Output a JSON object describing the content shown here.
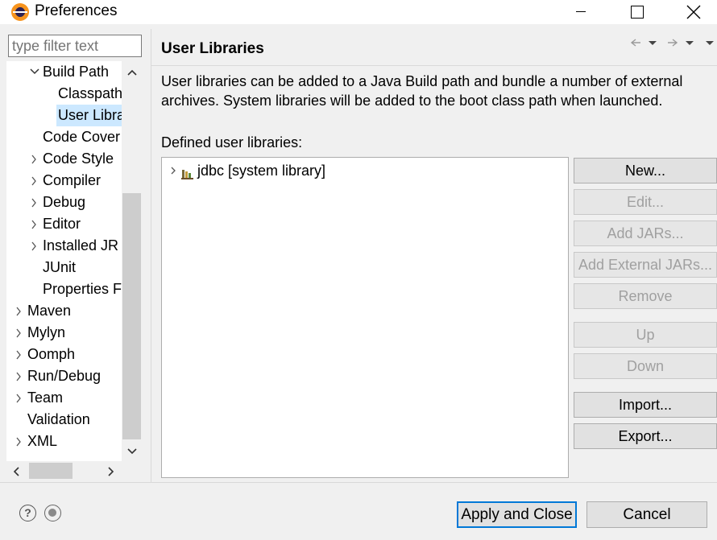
{
  "window": {
    "title": "Preferences"
  },
  "filter": {
    "placeholder": "type filter text"
  },
  "tree": {
    "items": [
      {
        "label": "Build Path",
        "indent": 1,
        "chevron": "down"
      },
      {
        "label": "Classpath",
        "indent": 2,
        "chevron": "none"
      },
      {
        "label": "User Libra",
        "indent": 2,
        "chevron": "none",
        "selected": true
      },
      {
        "label": "Code Cover",
        "indent": 1,
        "chevron": "none"
      },
      {
        "label": "Code Style",
        "indent": 1,
        "chevron": "right"
      },
      {
        "label": "Compiler",
        "indent": 1,
        "chevron": "right"
      },
      {
        "label": "Debug",
        "indent": 1,
        "chevron": "right"
      },
      {
        "label": "Editor",
        "indent": 1,
        "chevron": "right"
      },
      {
        "label": "Installed JR",
        "indent": 1,
        "chevron": "right"
      },
      {
        "label": "JUnit",
        "indent": 1,
        "chevron": "none"
      },
      {
        "label": "Properties F",
        "indent": 1,
        "chevron": "none"
      },
      {
        "label": "Maven",
        "indent": 0,
        "chevron": "right"
      },
      {
        "label": "Mylyn",
        "indent": 0,
        "chevron": "right"
      },
      {
        "label": "Oomph",
        "indent": 0,
        "chevron": "right"
      },
      {
        "label": "Run/Debug",
        "indent": 0,
        "chevron": "right"
      },
      {
        "label": "Team",
        "indent": 0,
        "chevron": "right"
      },
      {
        "label": "Validation",
        "indent": 0,
        "chevron": "none"
      },
      {
        "label": "XML",
        "indent": 0,
        "chevron": "right"
      }
    ]
  },
  "page": {
    "title": "User Libraries",
    "description": "User libraries can be added to a Java Build path and bundle a number of external archives. System libraries will be added to the boot class path when launched.",
    "list_label": "Defined user libraries:",
    "libraries": [
      {
        "label": "jdbc [system library]"
      }
    ]
  },
  "buttons": {
    "new": "New...",
    "edit": "Edit...",
    "add_jars": "Add JARs...",
    "add_external_jars": "Add External JARs...",
    "remove": "Remove",
    "up": "Up",
    "down": "Down",
    "import": "Import...",
    "export": "Export..."
  },
  "footer": {
    "help_glyph": "?",
    "apply_close": "Apply and Close",
    "cancel": "Cancel"
  },
  "colors": {
    "selection": "#cce8ff",
    "default_button_border": "#0078d7"
  }
}
